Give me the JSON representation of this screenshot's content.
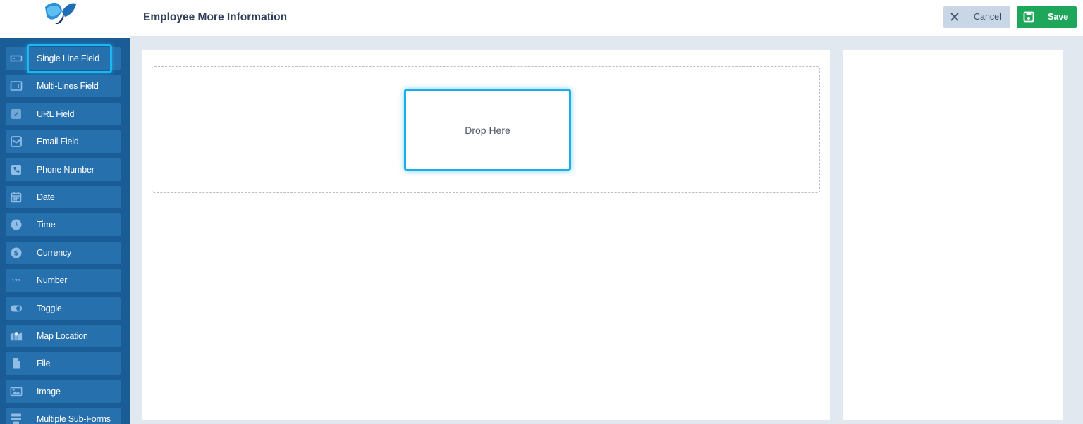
{
  "header": {
    "title": "Employee More Information",
    "cancel_label": "Cancel",
    "save_label": "Save"
  },
  "sidebar": {
    "items": [
      {
        "label": "Single Line Field",
        "icon": "single-line-field-icon"
      },
      {
        "label": "Multi-Lines Field",
        "icon": "multi-lines-field-icon"
      },
      {
        "label": "URL Field",
        "icon": "link-icon"
      },
      {
        "label": "Email Field",
        "icon": "email-icon"
      },
      {
        "label": "Phone Number",
        "icon": "phone-icon"
      },
      {
        "label": "Date",
        "icon": "calendar-icon"
      },
      {
        "label": "Time",
        "icon": "clock-icon"
      },
      {
        "label": "Currency",
        "icon": "dollar-icon"
      },
      {
        "label": "Number",
        "icon": "number-icon"
      },
      {
        "label": "Toggle",
        "icon": "toggle-icon"
      },
      {
        "label": "Map Location",
        "icon": "map-icon"
      },
      {
        "label": "File",
        "icon": "file-icon"
      },
      {
        "label": "Image",
        "icon": "image-icon"
      },
      {
        "label": "Multiple Sub-Forms",
        "icon": "sub-forms-icon"
      }
    ]
  },
  "canvas": {
    "drop_label": "Drop Here"
  },
  "colors": {
    "sidebar_bg": "#1a5d96",
    "sidebar_item": "#2770ae",
    "highlight": "#19b8f0",
    "save": "#1ea65b",
    "cancel": "#c9d6e6"
  }
}
